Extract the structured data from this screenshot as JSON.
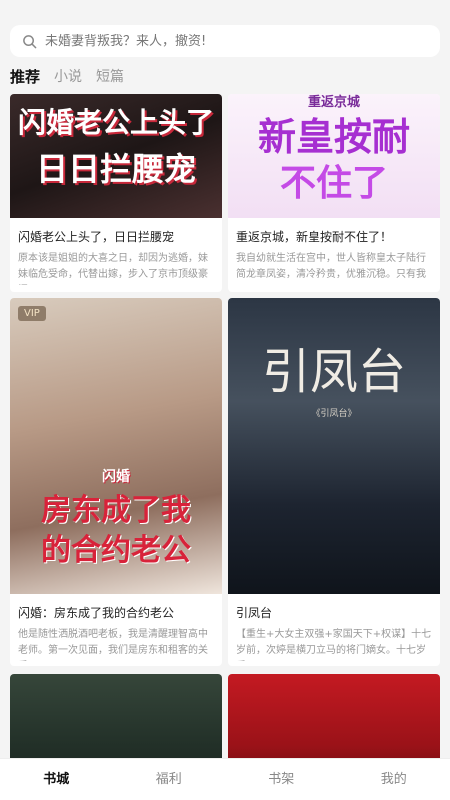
{
  "search": {
    "placeholder": "未婚妻背叛我？来人，撤资!"
  },
  "tabs": [
    {
      "label": "推荐"
    },
    {
      "label": "小说"
    },
    {
      "label": "短篇"
    }
  ],
  "books": [
    {
      "cover_text_1": "闪婚老公上头了",
      "cover_text_2": "日日拦腰宠",
      "title": "闪婚老公上头了，日日拦腰宠",
      "desc": "原本该是姐姐的大喜之日，却因为逃婚，妹妹临危受命，代替出嫁，步入了京市顶级豪门"
    },
    {
      "cover_tag": "重返京城",
      "cover_text_1": "新皇按耐",
      "cover_text_2": "不住了",
      "title": "重返京城，新皇按耐不住了！",
      "desc": "我自幼就生活在宫中，世人皆称皇太子陆行简龙章凤姿，清冷矜贵，优雅沉稳。只有我"
    },
    {
      "badge": "VIP",
      "cover_tag": "闪婚",
      "cover_text_1": "房东成了我",
      "cover_text_2": "的合约老公",
      "title": "闪婚：房东成了我的合约老公",
      "desc": "他是随性洒脱酒吧老板，我是清醒理智高中老师。第一次见面，我们是房东和租客的关系"
    },
    {
      "cover_text_1": "引凤台",
      "cover_sub": "《引凤台》",
      "title": "引凤台",
      "desc": "【重生+大女主双强+家国天下+权谋】十七岁前，次婷是横刀立马的将门嫡女。十七岁后"
    }
  ],
  "nav": [
    {
      "label": "书城"
    },
    {
      "label": "福利"
    },
    {
      "label": "书架"
    },
    {
      "label": "我的"
    }
  ],
  "colors": {
    "background": "#f4f4f4",
    "cover_red": "#d8233a",
    "cover_purple": "#9b2dc9",
    "nav_active": "#111111"
  }
}
